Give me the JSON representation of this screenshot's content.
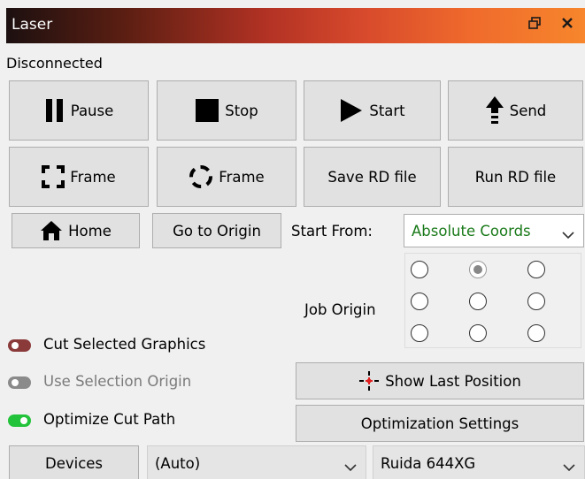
{
  "window": {
    "title": "Laser"
  },
  "status": "Disconnected",
  "buttons": {
    "pause": "Pause",
    "stop": "Stop",
    "start": "Start",
    "send": "Send",
    "frame_rect": "Frame",
    "frame_circle": "Frame",
    "save_rd": "Save RD file",
    "run_rd": "Run RD file",
    "home": "Home",
    "go_origin": "Go to Origin",
    "show_last_position": "Show Last Position",
    "optimization_settings": "Optimization Settings",
    "devices": "Devices"
  },
  "start_from": {
    "label": "Start From:",
    "value": "Absolute Coords"
  },
  "job_origin": {
    "label": "Job Origin",
    "selected_row": 0,
    "selected_col": 1
  },
  "toggles": {
    "cut_selected": {
      "label": "Cut Selected Graphics",
      "state": "off",
      "color": "#8b3a3a"
    },
    "use_selection_origin": {
      "label": "Use Selection Origin",
      "state": "off",
      "disabled": true,
      "color": "#8a8a8a"
    },
    "optimize_cut_path": {
      "label": "Optimize Cut Path",
      "state": "on",
      "color": "#22c33a"
    }
  },
  "port_combo": {
    "value": "(Auto)"
  },
  "device_combo": {
    "value": "Ruida 644XG"
  },
  "icons": {
    "restore": "restore-icon",
    "close": "close-icon"
  },
  "colors": {
    "crosshair": "#e02020",
    "start_from_text": "#1a7a1a"
  }
}
